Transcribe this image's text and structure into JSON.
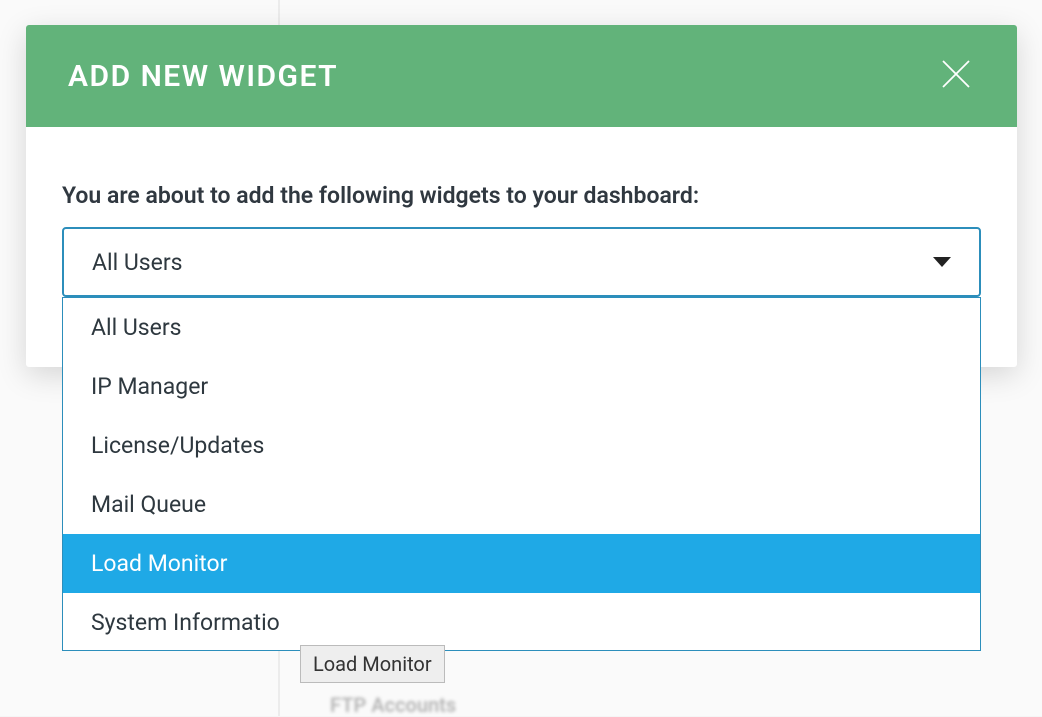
{
  "background": {
    "blurred_text": "FTP Accounts"
  },
  "modal": {
    "title": "ADD NEW WIDGET",
    "prompt": "You are about to add the following widgets to your dashboard:",
    "select": {
      "selected": "All Users",
      "options": [
        {
          "label": "All Users",
          "highlighted": false
        },
        {
          "label": "IP Manager",
          "highlighted": false
        },
        {
          "label": "License/Updates",
          "highlighted": false
        },
        {
          "label": "Mail Queue",
          "highlighted": false
        },
        {
          "label": "Load Monitor",
          "highlighted": true
        },
        {
          "label": "System Informatio",
          "highlighted": false
        }
      ]
    }
  },
  "tooltip": "Load Monitor"
}
